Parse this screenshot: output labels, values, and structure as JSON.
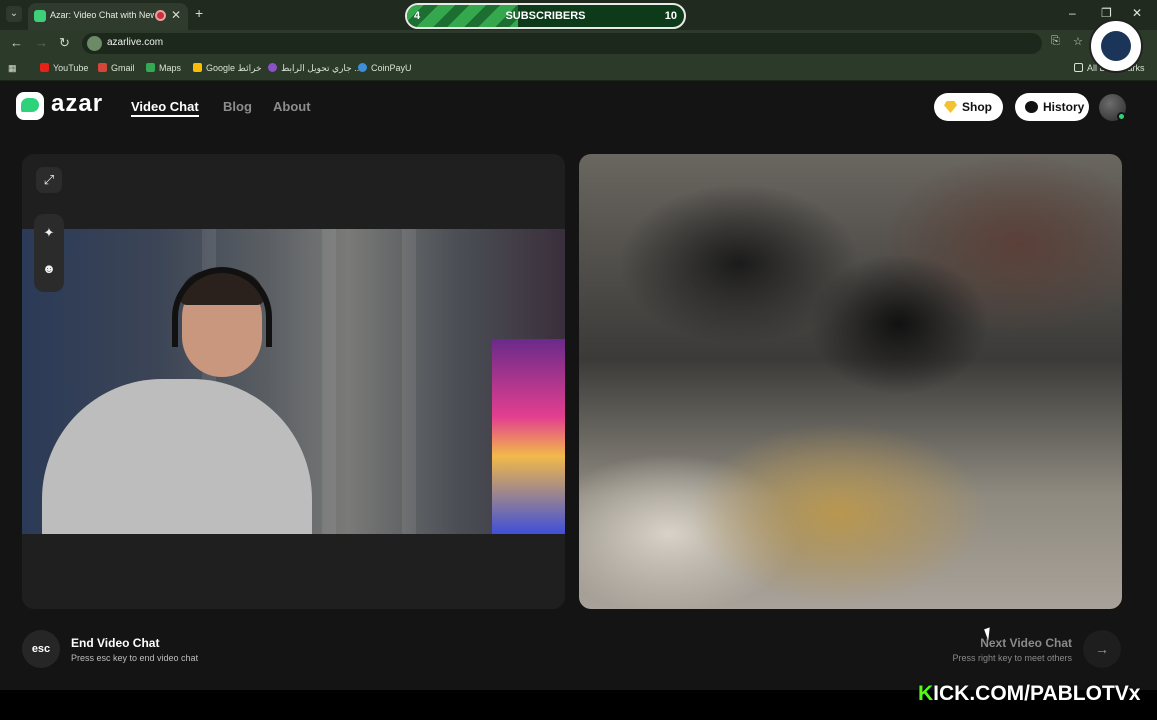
{
  "browser": {
    "tab_title": "Azar: Video Chat with New",
    "new_tab": "+",
    "url": "azarlive.com",
    "bookmarks": [
      "YouTube",
      "Gmail",
      "Maps",
      "Google خرائط",
      "جاري تحويل الرابط ...",
      "CoinPayU"
    ],
    "all_bookmarks": "All Bookmarks"
  },
  "overlay": {
    "subs_start": "4",
    "subs_label": "SUBSCRIBERS",
    "subs_end": "10",
    "subs_progress": 0.4,
    "kick_k": "K",
    "kick_rest": "ICK.COM/PABLOTVx"
  },
  "site": {
    "logo": "azar",
    "nav": [
      "Video Chat",
      "Blog",
      "About"
    ],
    "shop": "Shop",
    "history": "History"
  },
  "controls": {
    "esc_key": "esc",
    "end_title": "End Video Chat",
    "end_hint": "Press esc key to end video chat",
    "next_title": "Next Video Chat",
    "next_hint": "Press right key to meet others"
  },
  "colors": {
    "brand": "#2ed27a",
    "subs_fill": "#35a84d",
    "kick_green": "#53fc18"
  }
}
